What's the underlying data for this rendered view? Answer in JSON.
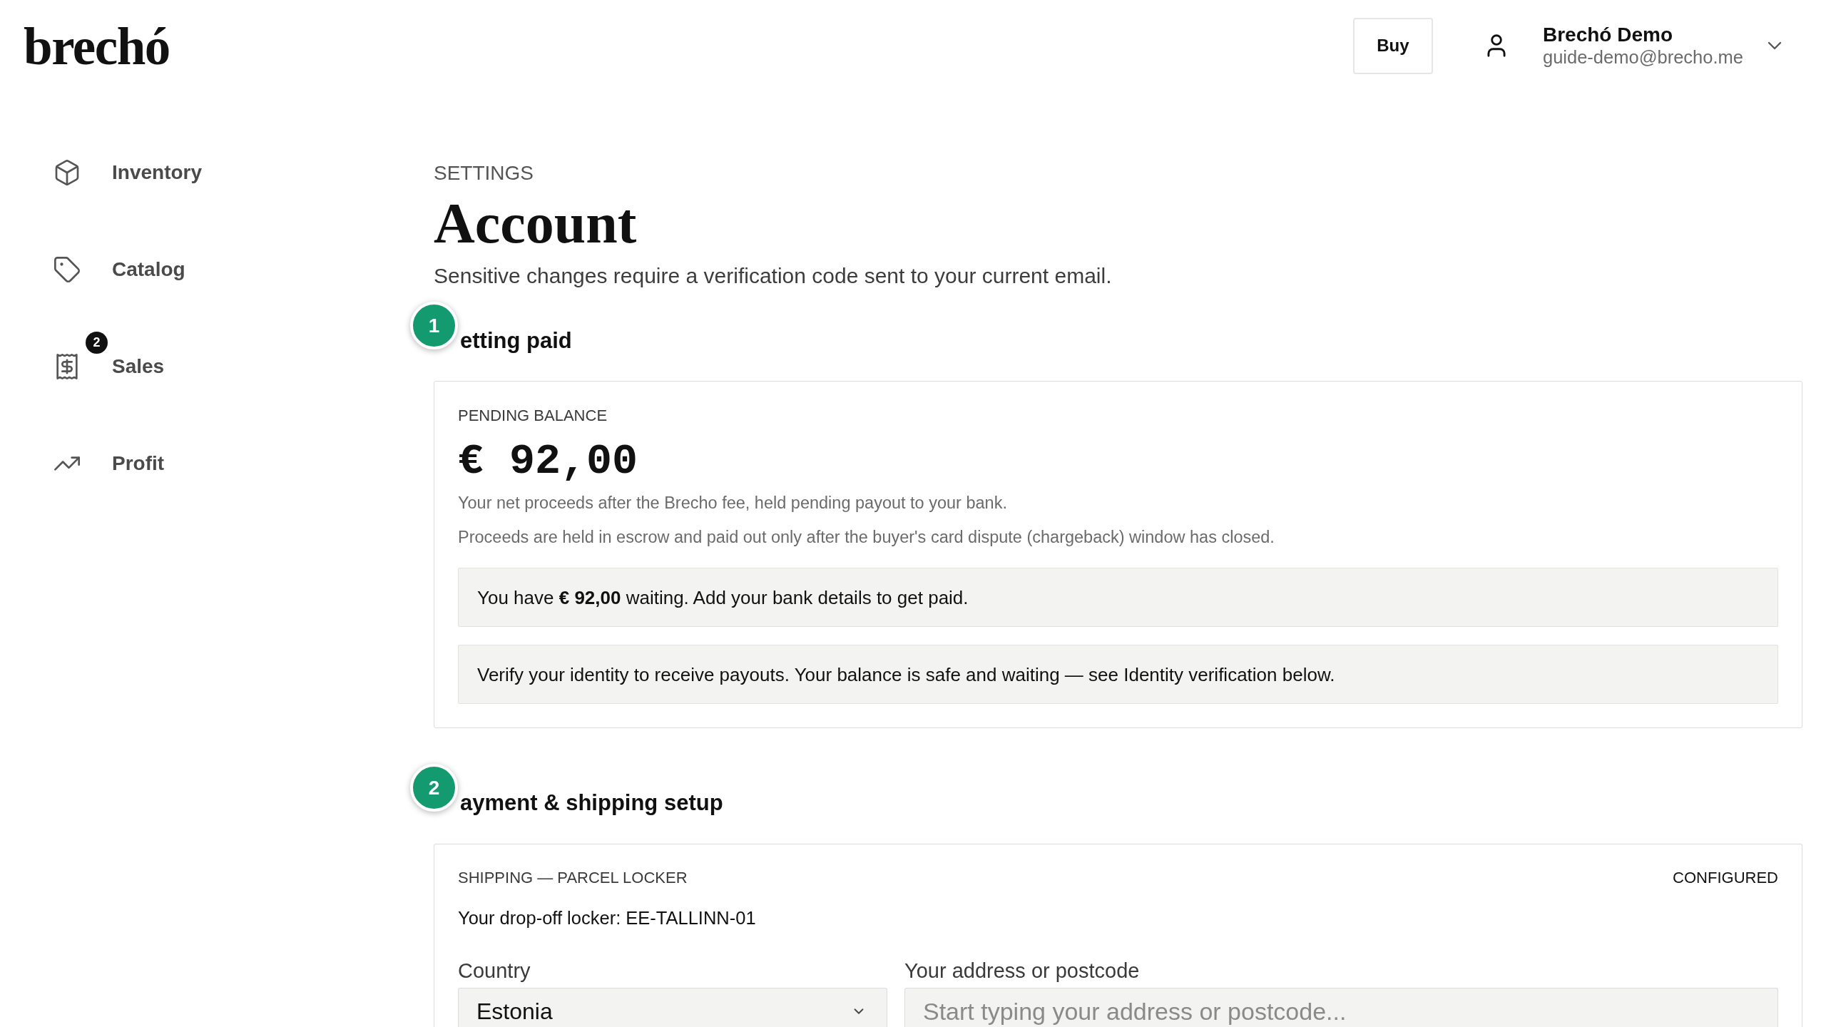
{
  "header": {
    "logo": "brechó",
    "buy_button": "Buy",
    "user": {
      "name": "Brechó Demo",
      "email": "guide-demo@brecho.me"
    }
  },
  "sidebar": {
    "items": [
      {
        "label": "Inventory"
      },
      {
        "label": "Catalog"
      },
      {
        "label": "Sales",
        "badge": "2"
      },
      {
        "label": "Profit"
      }
    ]
  },
  "page": {
    "eyebrow": "SETTINGS",
    "title": "Account",
    "subtitle": "Sensitive changes require a verification code sent to your current email."
  },
  "sections": [
    {
      "kind": "balance",
      "step": "1",
      "heading": "etting paid",
      "label": "PENDING BALANCE",
      "amount": "€ 92,00",
      "notes": [
        "Your net proceeds after the Brecho fee, held pending payout to your bank.",
        "Proceeds are held in escrow and paid out only after the buyer's card dispute (chargeback) window has closed."
      ],
      "notices": [
        "You have **€ 92,00** waiting. Add your bank details to get paid.",
        "Verify your identity to receive payouts. Your balance is safe and waiting — see Identity verification below."
      ]
    },
    {
      "kind": "shipping",
      "step": "2",
      "heading": "ayment & shipping setup",
      "label": "SHIPPING — PARCEL LOCKER",
      "status": "CONFIGURED",
      "locker": "Your drop-off locker: EE-TALLINN-01",
      "fields": [
        {
          "kind": "select",
          "label": "Country",
          "value": "Estonia"
        },
        {
          "kind": "text",
          "label": "Your address or postcode",
          "placeholder": "Start typing your address or postcode..."
        }
      ]
    }
  ]
}
